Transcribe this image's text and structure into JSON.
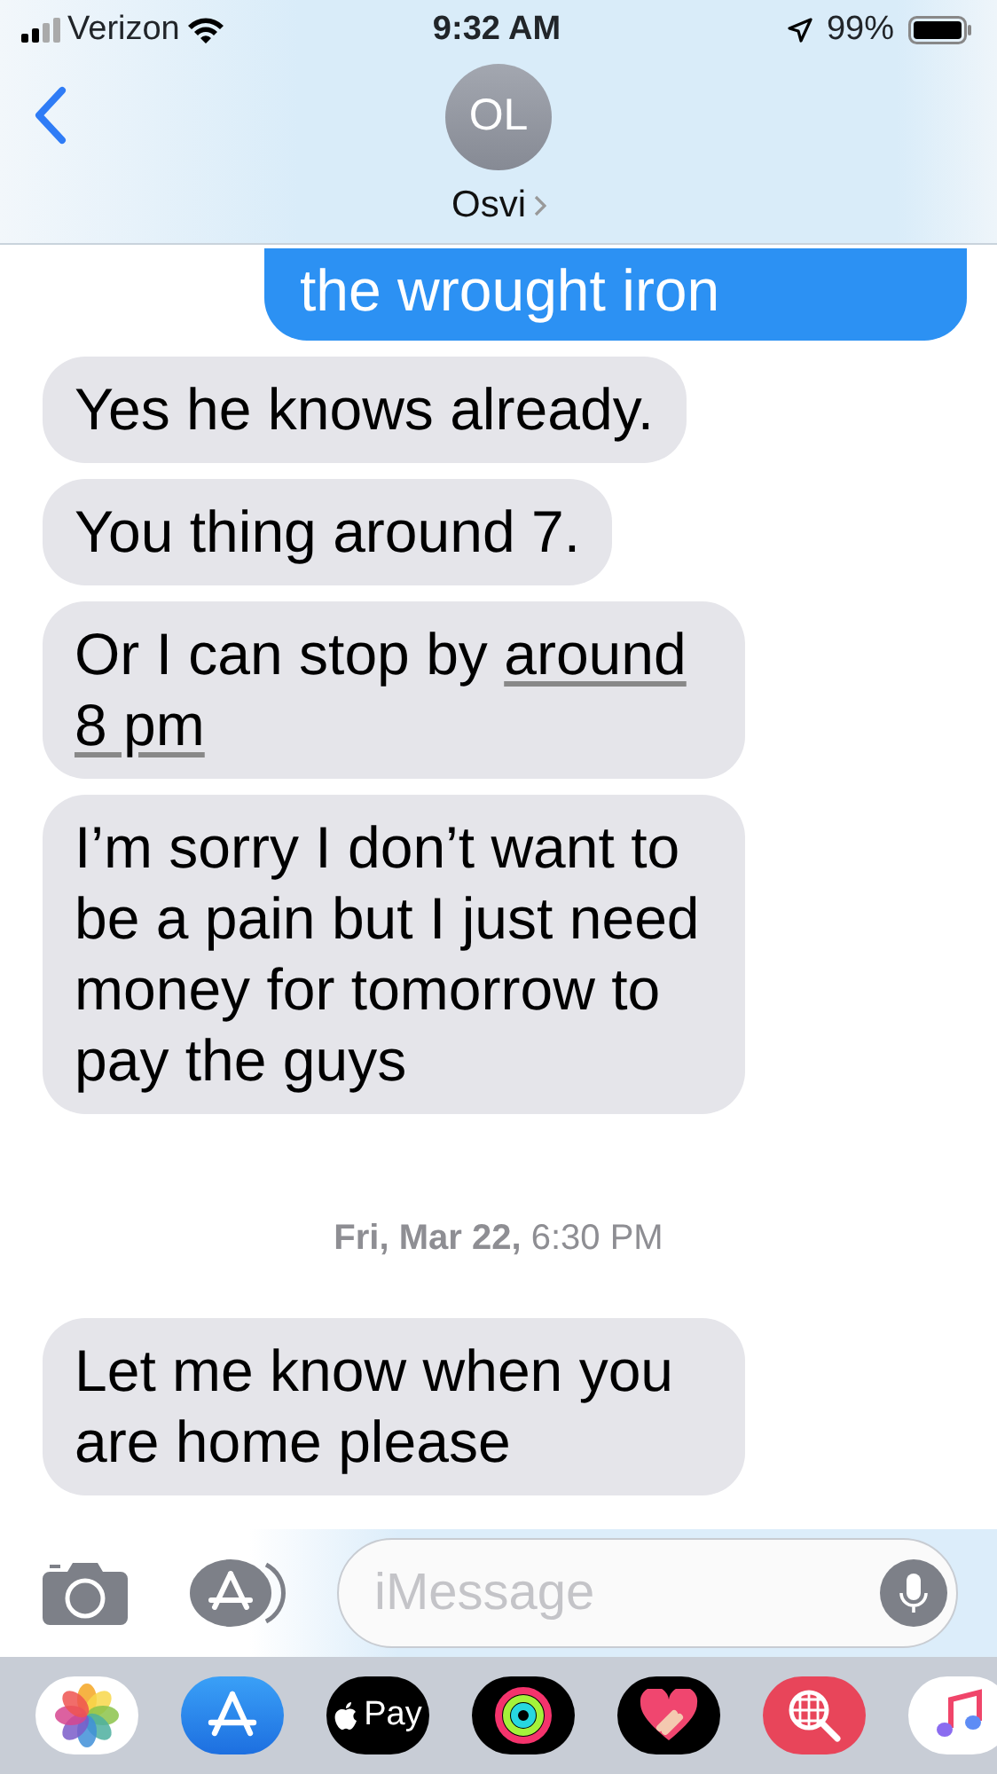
{
  "status_bar": {
    "carrier": "Verizon",
    "time": "9:32 AM",
    "battery": "99%"
  },
  "contact": {
    "initials": "OL",
    "name": "Osvi"
  },
  "messages": [
    {
      "kind": "sent",
      "parts": [
        {
          "text": "the wrought iron",
          "link": false
        }
      ]
    },
    {
      "kind": "received",
      "parts": [
        {
          "text": "Yes he knows already.",
          "link": false
        }
      ]
    },
    {
      "kind": "received",
      "parts": [
        {
          "text": "You thing around 7.",
          "link": false
        }
      ]
    },
    {
      "kind": "received",
      "parts": [
        {
          "text": "Or I can stop by ",
          "link": false
        },
        {
          "text": "around 8 pm",
          "link": true
        }
      ]
    },
    {
      "kind": "received",
      "parts": [
        {
          "text": "I’m sorry I don’t want to be a pain but I just need money for tomorrow to pay the guys",
          "link": false
        }
      ]
    },
    {
      "kind": "timestamp",
      "text": "**Fri, Mar 22,** 6:30 PM"
    },
    {
      "kind": "received",
      "parts": [
        {
          "text": "Let me know when you are home please",
          "link": false
        }
      ]
    }
  ],
  "compose": {
    "placeholder": "iMessage"
  },
  "app_drawer": [
    {
      "kind": "photos"
    },
    {
      "kind": "appstore"
    },
    {
      "kind": "applepay",
      "label": "Pay"
    },
    {
      "kind": "activity"
    },
    {
      "kind": "heart"
    },
    {
      "kind": "search"
    },
    {
      "kind": "music"
    }
  ]
}
